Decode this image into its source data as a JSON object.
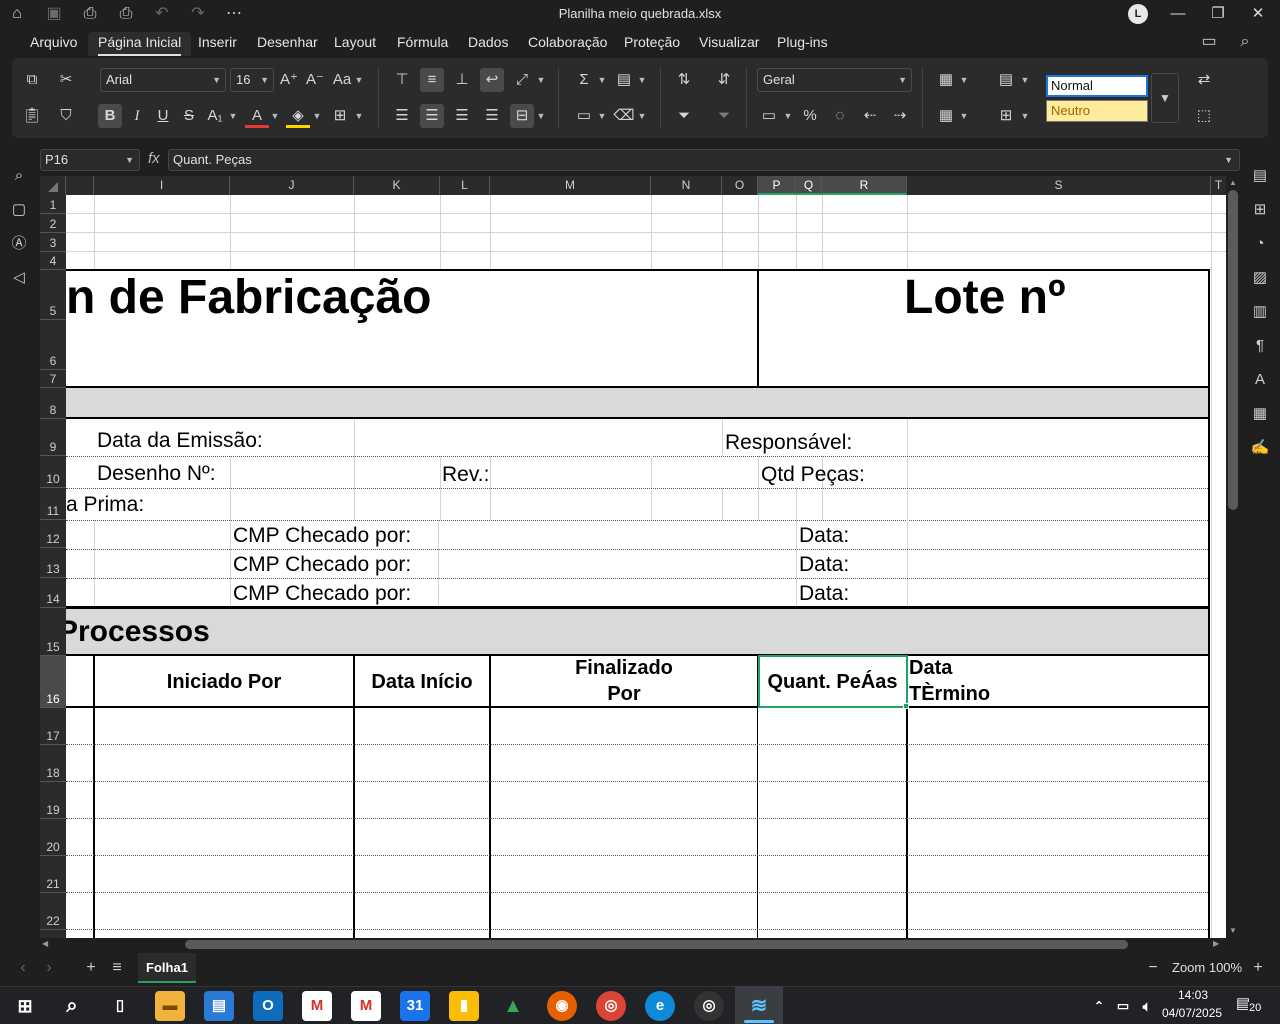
{
  "window": {
    "title": "Planilha meio quebrada.xlsx",
    "user_initial": "L"
  },
  "menu": [
    "Arquivo",
    "Página Inicial",
    "Inserir",
    "Desenhar",
    "Layout",
    "Fórmula",
    "Dados",
    "Colaboração",
    "Proteção",
    "Visualizar",
    "Plug-ins"
  ],
  "ribbon": {
    "font_name": "Arial",
    "font_size": "16",
    "number_format": "Geral",
    "styles": {
      "normal": "Normal",
      "neutro": "Neutro"
    }
  },
  "formula_bar": {
    "cell_ref": "P16",
    "fx": "fx",
    "content": "Quant. Peças"
  },
  "columns": [
    "I",
    "J",
    "K",
    "L",
    "M",
    "N",
    "O",
    "P",
    "Q",
    "R",
    "S",
    "T"
  ],
  "rows": [
    "1",
    "2",
    "3",
    "4",
    "5",
    "6",
    "7",
    "8",
    "9",
    "10",
    "11",
    "12",
    "13",
    "14",
    "15",
    "16",
    "17",
    "18",
    "19",
    "20",
    "21",
    "22"
  ],
  "sheet": {
    "title_fabricacao": "n de Fabricação",
    "title_lote": "Lote nº",
    "data_emissao": "Data da Emissão:",
    "responsavel": "Responsável:",
    "desenho": "Desenho Nº:",
    "rev": "Rev.:",
    "qtd_pecas": "Qtd Peças:",
    "materia_prima": "a Prima:",
    "cmp1": "CMP Checado por:",
    "cmp2": "CMP Checado por:",
    "cmp3": "CMP Checado por:",
    "data1": "Data:",
    "data2": "Data:",
    "data3": "Data:",
    "processos": "Processos",
    "h_iniciado": "Iniciado Por",
    "h_data_inicio": "Data Início",
    "h_finalizado_1": "Finalizado",
    "h_finalizado_2": "Por",
    "h_quant": "Quant. PeÁas",
    "h_data_term_1": "Data",
    "h_data_term_2": "TÈrmino"
  },
  "sheet_tabs": {
    "active": "Folha1"
  },
  "status": {
    "zoom": "Zoom 100%"
  },
  "taskbar": {
    "time": "14:03",
    "date": "04/07/2025",
    "notifications": "20"
  }
}
